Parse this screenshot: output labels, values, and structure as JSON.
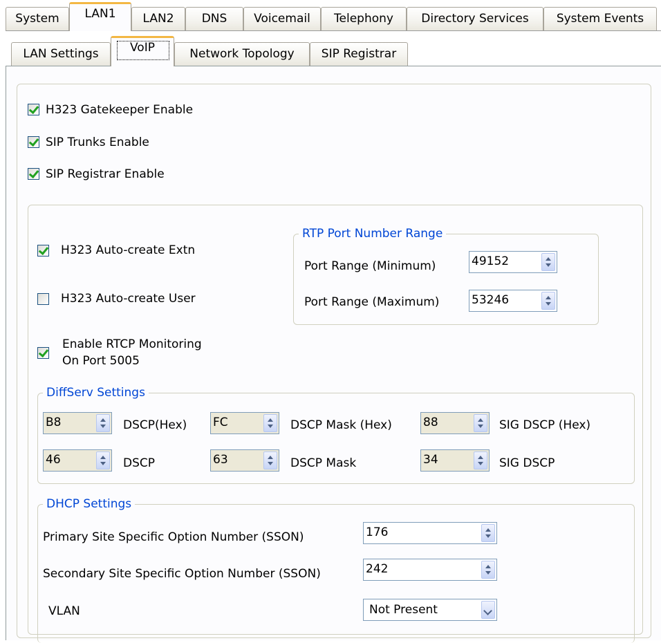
{
  "top_tabs": [
    "System",
    "LAN1",
    "LAN2",
    "DNS",
    "Voicemail",
    "Telephony",
    "Directory Services",
    "System Events"
  ],
  "sub_tabs": [
    "LAN Settings",
    "VoIP",
    "Network Topology",
    "SIP Registrar"
  ],
  "options": {
    "h323_gatekeeper": {
      "label": "H323 Gatekeeper Enable",
      "checked": true
    },
    "sip_trunks": {
      "label": "SIP Trunks Enable",
      "checked": true
    },
    "sip_registrar": {
      "label": "SIP Registrar Enable",
      "checked": true
    }
  },
  "voip": {
    "auto_create_extn": {
      "label": "H323 Auto-create Extn",
      "checked": true
    },
    "auto_create_user": {
      "label": "H323 Auto-create User",
      "checked": false
    },
    "rtcp_line1": "Enable RTCP Monitoring",
    "rtcp_line2": "On Port 5005",
    "rtcp_checked": true
  },
  "rtp": {
    "title": "RTP Port Number Range",
    "min_label": "Port Range (Minimum)",
    "min_value": "49152",
    "max_label": "Port Range (Maximum)",
    "max_value": "53246"
  },
  "diffserv": {
    "title": "DiffServ Settings",
    "dscp_hex": "B8",
    "dscp_hex_label": "DSCP(Hex)",
    "mask_hex": "FC",
    "mask_hex_label": "DSCP Mask (Hex)",
    "sig_hex": "88",
    "sig_hex_label": "SIG DSCP (Hex)",
    "dscp": "46",
    "dscp_label": "DSCP",
    "mask": "63",
    "mask_label": "DSCP Mask",
    "sig": "34",
    "sig_label": "SIG DSCP"
  },
  "dhcp": {
    "title": "DHCP Settings",
    "primary_label": "Primary Site Specific Option Number (SSON)",
    "primary_value": "176",
    "secondary_label": "Secondary Site Specific Option Number (SSON)",
    "secondary_value": "242",
    "vlan_label": "VLAN",
    "vlan_value": "Not Present"
  },
  "colors": {
    "group_title": "#0046d5",
    "active_tab_accent": "#f3b744",
    "check": "#21a121"
  }
}
